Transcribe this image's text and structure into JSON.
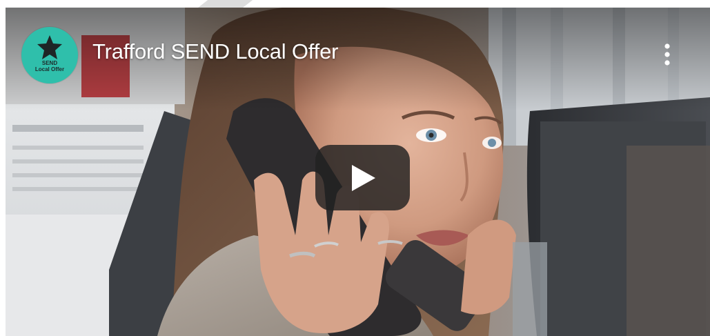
{
  "video": {
    "title": "Trafford SEND Local Offer"
  },
  "channel": {
    "avatar_line1": "SEND",
    "avatar_line2": "Local Offer",
    "avatar_color": "#2fbfab",
    "avatar_icon": "star-icon"
  },
  "controls": {
    "play_icon": "play-icon",
    "more_icon": "more-vertical-icon"
  }
}
